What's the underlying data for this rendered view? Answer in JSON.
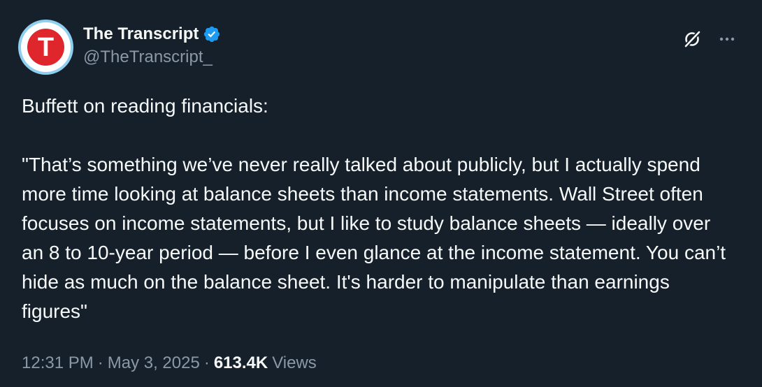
{
  "author": {
    "display_name": "The Transcript",
    "handle": "@TheTranscript_",
    "avatar_letter": "T",
    "verified": true,
    "verified_icon": "verified-badge-icon",
    "verified_color": "#1d9bf0"
  },
  "tweet": {
    "intro": "Buffett on reading financials:",
    "quote": "\"That’s something we’ve never really talked about publicly, but I actually spend more time looking at balance sheets than income statements. Wall Street often focuses on income statements, but I like to study balance sheets — ideally over an 8 to 10-year period — before I even glance at the income statement. You can’t hide as much on the balance sheet. It's harder to manipulate than earnings figures\""
  },
  "meta": {
    "time": "12:31 PM",
    "separator": "·",
    "date": "May 3, 2025",
    "views_count": "613.4K",
    "views_label": "Views"
  },
  "actions": {
    "grok_icon": "grok-icon",
    "more_icon": "more-options-icon"
  },
  "colors": {
    "background": "#15202b",
    "text_primary": "#f7f9f9",
    "text_secondary": "#8b98a5",
    "avatar_ring": "#8ecff0",
    "avatar_logo": "#e0262d"
  }
}
